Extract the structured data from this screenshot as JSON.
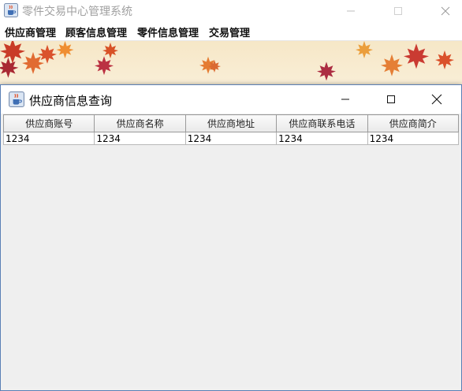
{
  "main_window": {
    "title": "零件交易中心管理系统",
    "icon": "java-cup-icon"
  },
  "menubar": {
    "items": [
      "供应商管理",
      "顾客信息管理",
      "零件信息管理",
      "交易管理"
    ]
  },
  "dialog": {
    "title": "供应商信息查询",
    "icon": "java-cup-icon"
  },
  "table": {
    "columns": [
      "供应商账号",
      "供应商名称",
      "供应商地址",
      "供应商联系电话",
      "供应商简介"
    ],
    "rows": [
      [
        "1234",
        "1234",
        "1234",
        "1234",
        "1234"
      ]
    ]
  }
}
